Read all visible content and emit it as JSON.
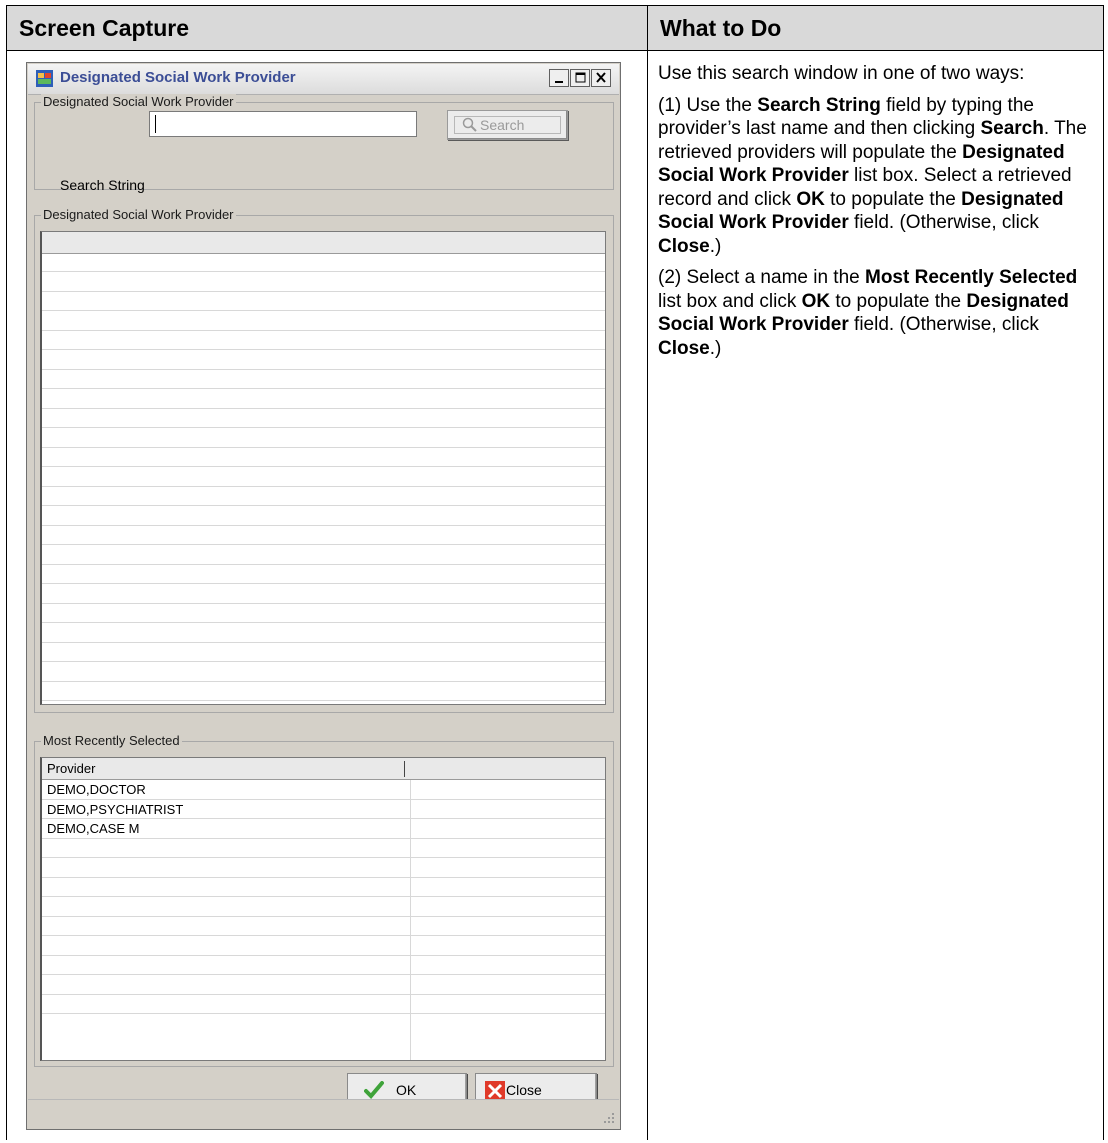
{
  "header": {
    "left": "Screen Capture",
    "right": "What to Do"
  },
  "window": {
    "title": "Designated Social Work Provider",
    "search_group": {
      "label": "Designated Social Work Provider",
      "field_label": "Search String",
      "field_value": "",
      "search_button": "Search"
    },
    "results_group": {
      "label": "Designated Social Work Provider",
      "rows": [
        "",
        "",
        "",
        "",
        "",
        "",
        "",
        "",
        "",
        "",
        "",
        "",
        "",
        "",
        "",
        "",
        "",
        "",
        "",
        "",
        "",
        "",
        ""
      ]
    },
    "recent_group": {
      "label": "Most Recently Selected",
      "column": "Provider",
      "rows": [
        "DEMO,DOCTOR",
        "DEMO,PSYCHIATRIST",
        "DEMO,CASE M",
        "",
        "",
        "",
        "",
        "",
        "",
        "",
        "",
        ""
      ]
    },
    "buttons": {
      "ok": "OK",
      "close": "Close"
    }
  },
  "instructions": {
    "p1": "Use this search window in one of two ways:",
    "p2": [
      {
        "t": "(1) Use the ",
        "b": false
      },
      {
        "t": "Search String",
        "b": true
      },
      {
        "t": " field by typing the provider’s last name and then clicking ",
        "b": false
      },
      {
        "t": "Search",
        "b": true
      },
      {
        "t": ". The retrieved providers will populate the ",
        "b": false
      },
      {
        "t": "Designated Social Work Provider",
        "b": true
      },
      {
        "t": " list box. Select a retrieved record and click ",
        "b": false
      },
      {
        "t": "OK",
        "b": true
      },
      {
        "t": " to populate the ",
        "b": false
      },
      {
        "t": "Designated Social Work Provider",
        "b": true
      },
      {
        "t": " field. (Otherwise, click ",
        "b": false
      },
      {
        "t": "Close",
        "b": true
      },
      {
        "t": ".)",
        "b": false
      }
    ],
    "p3": [
      {
        "t": "(2) Select a name in the ",
        "b": false
      },
      {
        "t": "Most Recently Selected",
        "b": true
      },
      {
        "t": " list box and click ",
        "b": false
      },
      {
        "t": "OK",
        "b": true
      },
      {
        "t": " to populate the ",
        "b": false
      },
      {
        "t": "Designated Social Work Provider",
        "b": true
      },
      {
        "t": " field. (Otherwise, click ",
        "b": false
      },
      {
        "t": "Close",
        "b": true
      },
      {
        "t": ".)",
        "b": false
      }
    ]
  }
}
